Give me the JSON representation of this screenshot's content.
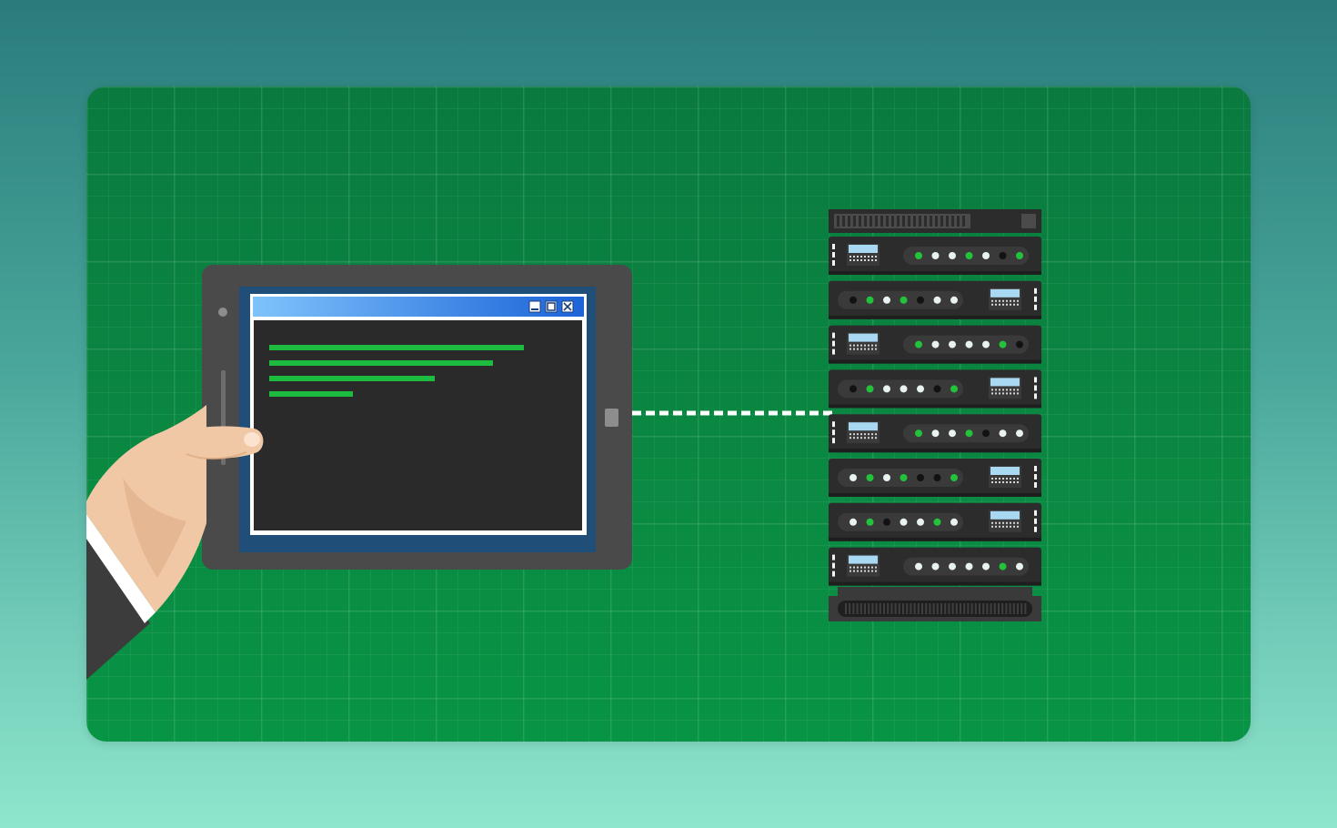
{
  "scene": {
    "type": "illustration",
    "subject": "hand-holding-tablet-connected-to-server-rack",
    "colors": {
      "page_gradient_top": "#2a7c7c",
      "page_gradient_bottom": "#8fe6cd",
      "card_green": "#0a8841",
      "tablet_body": "#4a4a4a",
      "tablet_bezel_blue": "#1f4f78",
      "window_title_blue": "#2b7ff0",
      "terminal_bg": "#2a2a2a",
      "terminal_text_green": "#1dbb3f",
      "server_dark": "#2c2c2c",
      "led_green": "#22c33a",
      "led_white": "#e8f2ee",
      "led_off": "#121212",
      "skin": "#f0c8a5",
      "sleeve": "#3c3c3c"
    }
  },
  "tablet": {
    "icons": [
      "camera-icon",
      "home-button-icon"
    ],
    "window_controls": [
      "minimize-icon",
      "maximize-icon",
      "close-icon"
    ],
    "terminal_lines": [
      {
        "length": 1.0
      },
      {
        "length": 0.88
      },
      {
        "length": 0.65
      },
      {
        "length": 0.33
      }
    ]
  },
  "server_rack": {
    "units": [
      {
        "display": "left",
        "leds": [
          "green",
          "white",
          "white",
          "green",
          "white",
          "off",
          "green"
        ]
      },
      {
        "display": "right",
        "leds": [
          "off",
          "green",
          "white",
          "green",
          "off",
          "white",
          "white"
        ]
      },
      {
        "display": "left",
        "leds": [
          "green",
          "white",
          "white",
          "white",
          "white",
          "green",
          "off"
        ]
      },
      {
        "display": "right",
        "leds": [
          "off",
          "green",
          "white",
          "white",
          "white",
          "off",
          "green"
        ]
      },
      {
        "display": "left",
        "leds": [
          "green",
          "white",
          "white",
          "green",
          "off",
          "white",
          "white"
        ]
      },
      {
        "display": "right",
        "leds": [
          "white",
          "green",
          "white",
          "green",
          "off",
          "off",
          "green"
        ]
      },
      {
        "display": "right",
        "leds": [
          "white",
          "green",
          "off",
          "white",
          "white",
          "green",
          "white"
        ]
      },
      {
        "display": "left",
        "leds": [
          "white",
          "white",
          "white",
          "white",
          "white",
          "green",
          "white"
        ]
      }
    ]
  }
}
